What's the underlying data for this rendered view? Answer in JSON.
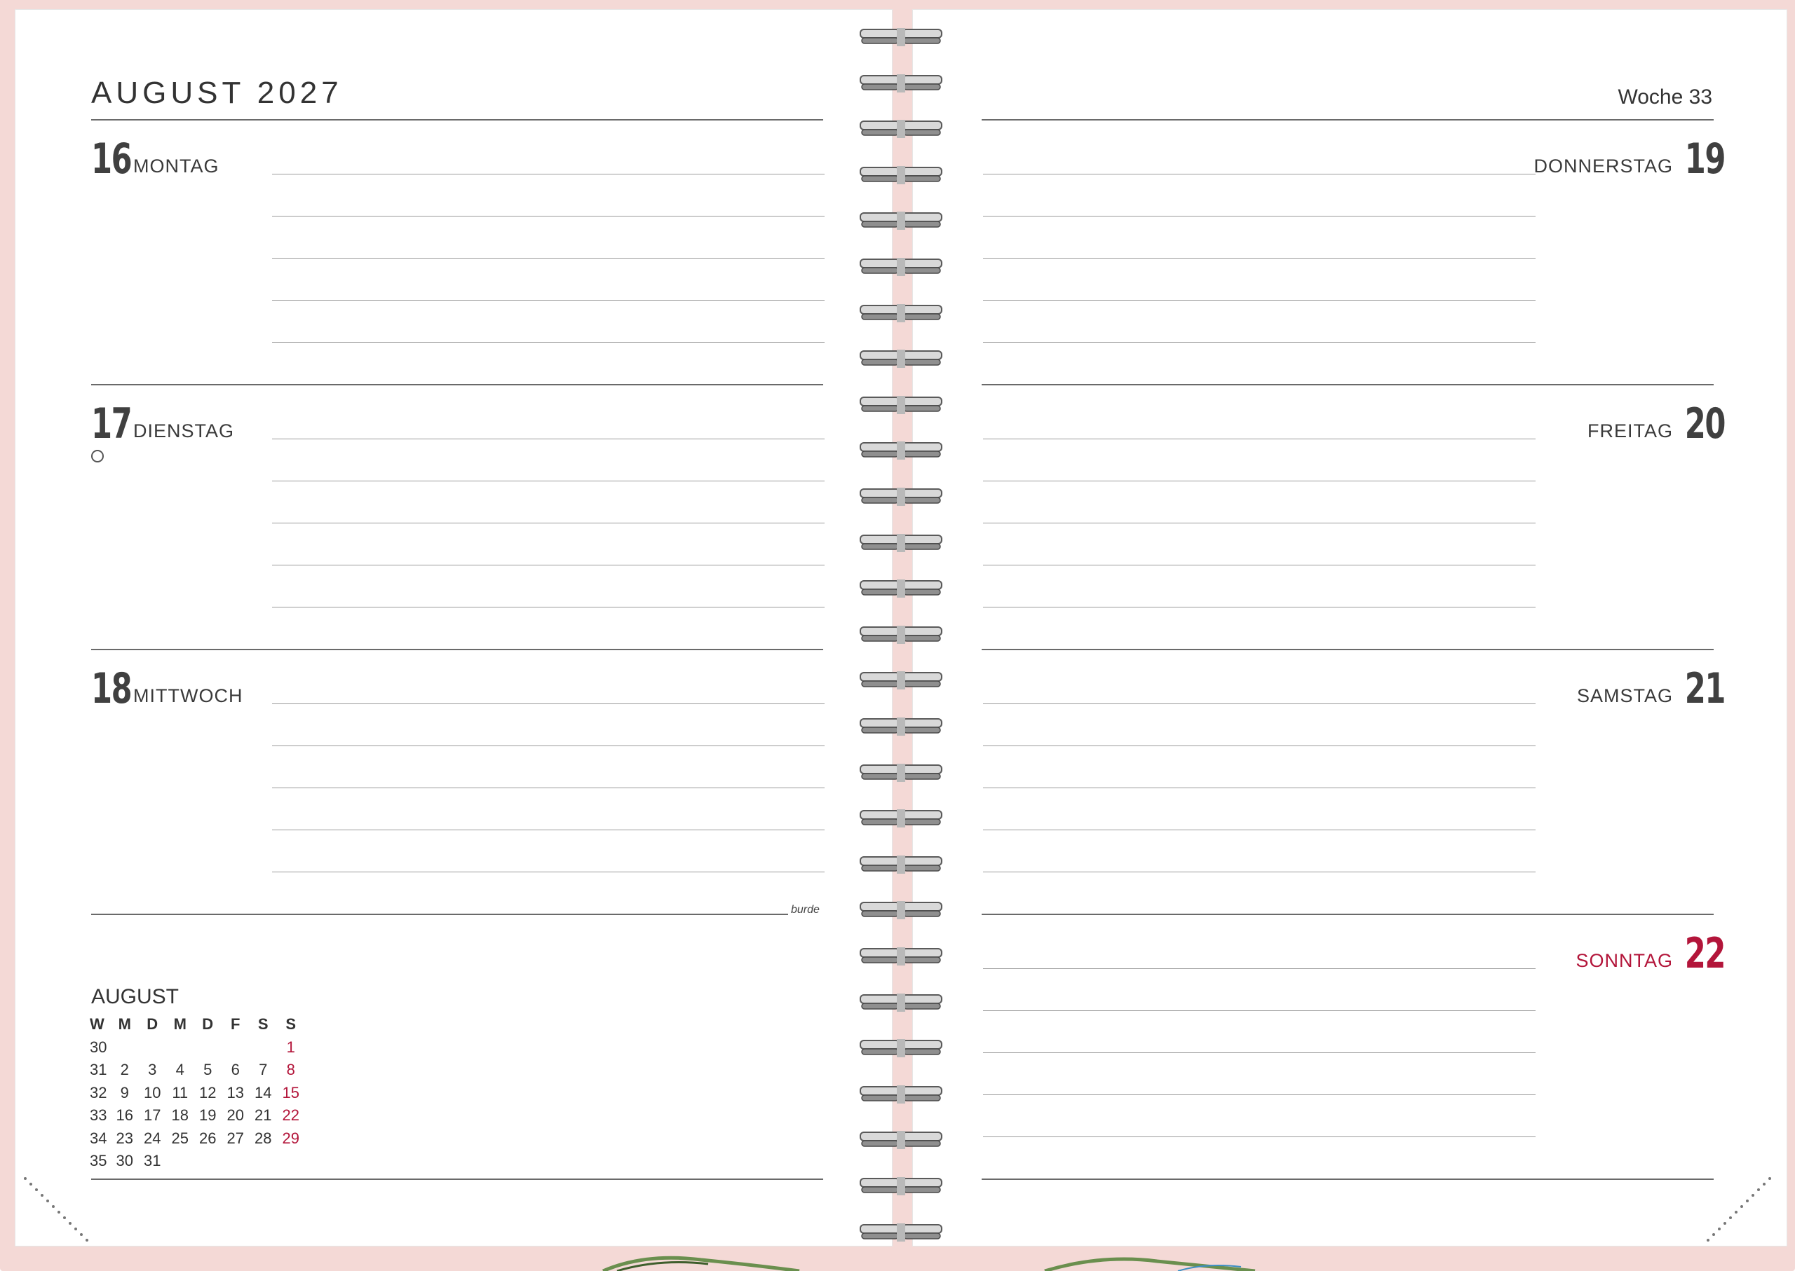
{
  "header": {
    "month_year": "AUGUST 2027",
    "week": "Woche 33"
  },
  "left_days": [
    {
      "number": "16",
      "name": "MONTAG",
      "moon": false
    },
    {
      "number": "17",
      "name": "DIENSTAG",
      "moon": true
    },
    {
      "number": "18",
      "name": "MITTWOCH",
      "moon": false
    }
  ],
  "right_days": [
    {
      "number": "19",
      "name": "DONNERSTAG",
      "sunday": false
    },
    {
      "number": "20",
      "name": "FREITAG",
      "sunday": false
    },
    {
      "number": "21",
      "name": "SAMSTAG",
      "sunday": false
    },
    {
      "number": "22",
      "name": "SONNTAG",
      "sunday": true
    }
  ],
  "brand": "burde",
  "mini_calendar": {
    "title": "AUGUST",
    "headers": [
      "W",
      "M",
      "D",
      "M",
      "D",
      "F",
      "S",
      "S"
    ],
    "weeks": [
      {
        "week": "30",
        "days": [
          "",
          "",
          "",
          "",
          "",
          "",
          "1"
        ]
      },
      {
        "week": "31",
        "days": [
          "2",
          "3",
          "4",
          "5",
          "6",
          "7",
          "8"
        ]
      },
      {
        "week": "32",
        "days": [
          "9",
          "10",
          "11",
          "12",
          "13",
          "14",
          "15"
        ]
      },
      {
        "week": "33",
        "days": [
          "16",
          "17",
          "18",
          "19",
          "20",
          "21",
          "22"
        ]
      },
      {
        "week": "34",
        "days": [
          "23",
          "24",
          "25",
          "26",
          "27",
          "28",
          "29"
        ]
      },
      {
        "week": "35",
        "days": [
          "30",
          "31",
          "",
          "",
          "",
          "",
          ""
        ]
      }
    ]
  },
  "colors": {
    "sunday_red": "#b3153a",
    "cover_pink": "#f4d9d6",
    "text_dark": "#2e2e2e"
  }
}
